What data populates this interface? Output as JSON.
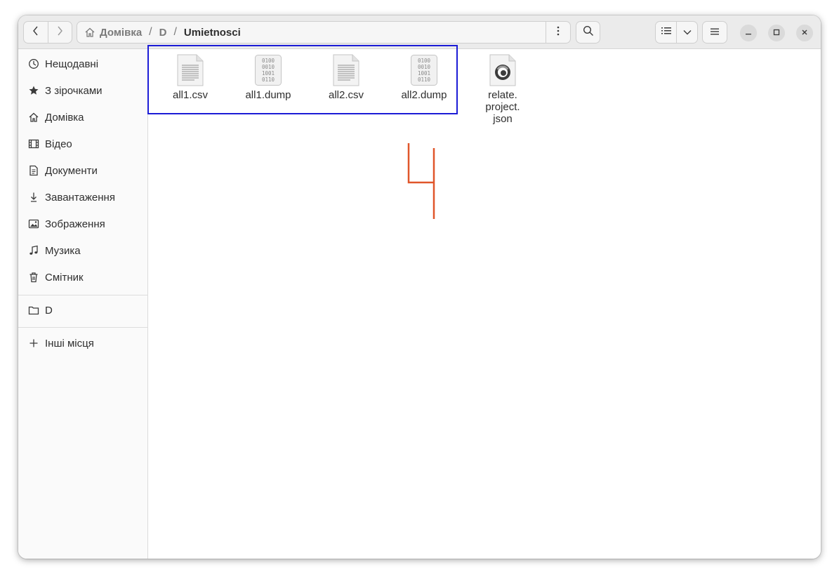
{
  "header": {
    "path": {
      "home_label": "Домівка",
      "crumb_1": "D",
      "current": "Umietnosci",
      "separator": "/"
    },
    "icons": {
      "back": "chevron-left-icon",
      "forward": "chevron-right-icon",
      "home": "home-icon",
      "path_menu": "vertical-dots-icon",
      "search": "search-icon",
      "list_view": "list-view-icon",
      "view_options": "chevron-down-icon",
      "main_menu": "hamburger-icon",
      "minimize": "minimize-icon",
      "maximize": "maximize-icon",
      "close": "close-icon"
    }
  },
  "sidebar": {
    "items": [
      {
        "label": "Нещодавні",
        "icon": "clock-icon"
      },
      {
        "label": "З зірочками",
        "icon": "star-icon"
      },
      {
        "label": "Домівка",
        "icon": "home-icon"
      },
      {
        "label": "Відео",
        "icon": "film-icon"
      },
      {
        "label": "Документи",
        "icon": "document-icon"
      },
      {
        "label": "Завантаження",
        "icon": "download-icon"
      },
      {
        "label": "Зображення",
        "icon": "image-icon"
      },
      {
        "label": "Музика",
        "icon": "music-icon"
      },
      {
        "label": "Смітник",
        "icon": "trash-icon"
      }
    ],
    "drives": [
      {
        "label": "D",
        "icon": "folder-icon"
      }
    ],
    "other": {
      "label": "Інші місця",
      "icon": "plus-icon"
    }
  },
  "files": [
    {
      "name": "all1.csv",
      "type": "text"
    },
    {
      "name": "all1.dump",
      "type": "binary"
    },
    {
      "name": "all2.csv",
      "type": "text"
    },
    {
      "name": "all2.dump",
      "type": "binary"
    },
    {
      "name": "relate.\nproject.\njson",
      "type": "json"
    }
  ],
  "binary_glyph": [
    "0100",
    "0010",
    "1001",
    "0110"
  ],
  "colors": {
    "selection_box": "#1c1cd6",
    "annotation_mark": "#e0562a"
  }
}
